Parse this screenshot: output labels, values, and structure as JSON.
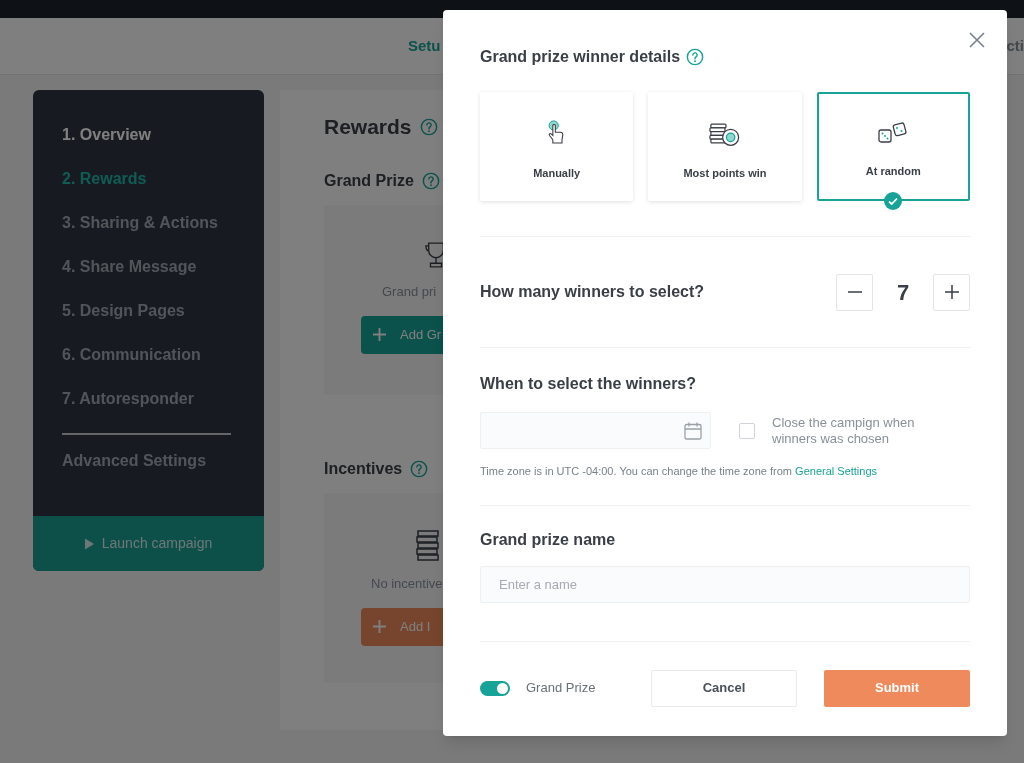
{
  "header": {
    "tabs": [
      {
        "label": "Setu",
        "selected": true
      },
      {
        "label": "cti",
        "selected": false
      }
    ]
  },
  "sidebar": {
    "items": [
      {
        "label": "1. Overview",
        "selected": false,
        "completed": true
      },
      {
        "label": "2. Rewards",
        "selected": true,
        "completed": false
      },
      {
        "label": "3. Sharing & Actions",
        "selected": false,
        "completed": false
      },
      {
        "label": "4. Share Message",
        "selected": false,
        "completed": false
      },
      {
        "label": "5. Design Pages",
        "selected": false,
        "completed": false
      },
      {
        "label": "6. Communication",
        "selected": false,
        "completed": false
      },
      {
        "label": "7. Autoresponder",
        "selected": false,
        "completed": false
      }
    ],
    "advanced": "Advanced Settings",
    "launch": "Launch campaign"
  },
  "main": {
    "title": "Rewards",
    "sections": [
      {
        "kind": "prize",
        "title": "Grand Prize",
        "empty_text": "Grand pri",
        "button": "Add Gr"
      },
      {
        "kind": "incentives",
        "title": "Incentives",
        "empty_text": "No incentive",
        "button": "Add I"
      }
    ]
  },
  "modal": {
    "title": "Grand prize winner details",
    "options": [
      {
        "kind": "hand",
        "label": "Manually",
        "selected": false
      },
      {
        "kind": "coins",
        "label": "Most points win",
        "selected": false
      },
      {
        "kind": "dice",
        "label": "At random",
        "selected": true
      }
    ],
    "winners_label": "How many winners to select?",
    "winners_count": "7",
    "when_label": "When to select the winners?",
    "close_label": "Close the campign when winners was chosen",
    "close_checked": false,
    "timezone_note": "Time zone is in UTC -04:00. You can change the time zone from",
    "timezone_link": "General Settings",
    "name_label": "Grand prize name",
    "name_placeholder": "Enter a name",
    "toggle": {
      "label": "Grand Prize",
      "on": true
    },
    "cancel": "Cancel",
    "submit": "Submit"
  }
}
